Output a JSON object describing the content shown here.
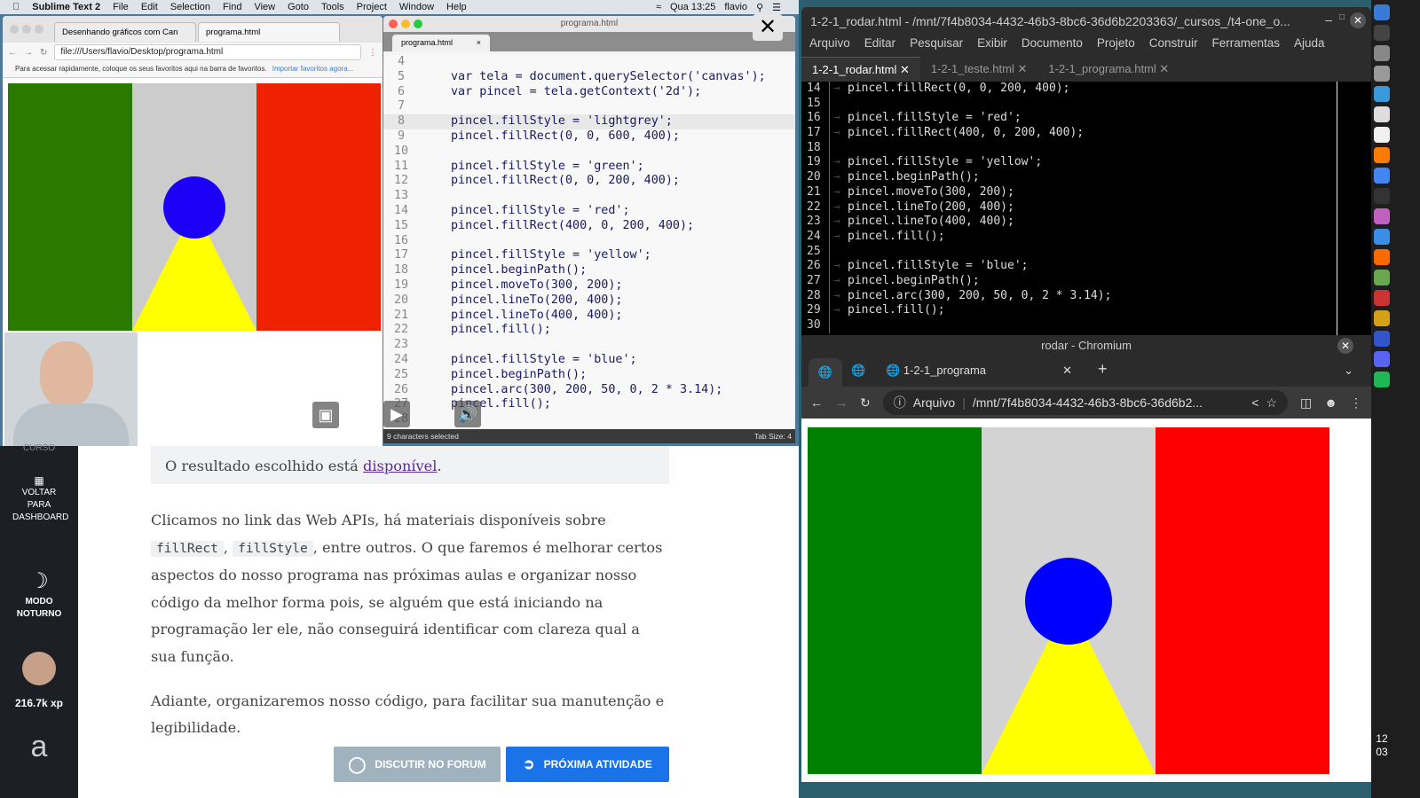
{
  "mac_menubar": {
    "app": "Sublime Text 2",
    "items": [
      "File",
      "Edit",
      "Selection",
      "Find",
      "View",
      "Goto",
      "Tools",
      "Project",
      "Window",
      "Help"
    ],
    "clock": "Qua 13:25",
    "user": "flavio"
  },
  "left_browser": {
    "tabs": [
      "Desenhando gráficos com Can",
      "programa.html"
    ],
    "url": "file:///Users/flavio/Desktop/programa.html",
    "bookmarks_hint": "Para acessar rapidamente, coloque os seus favoritos aqui na barra de favoritos.",
    "bookmarks_link": "Importar favoritos agora..."
  },
  "flag_colors": {
    "left": "#2a7a00",
    "middle": "#cccccc",
    "right": "#ee2200",
    "circle": "#1c00f6",
    "triangle": "#ffff00"
  },
  "sublime": {
    "window_title": "programa.html",
    "tab": "programa.html",
    "status_left": "9 characters selected",
    "status_right": "Tab Size: 4",
    "first_line": 4,
    "lines": [
      "",
      "var tela = document.querySelector('canvas');",
      "var pincel = tela.getContext('2d');",
      "",
      "pincel.fillStyle = 'lightgrey';",
      "pincel.fillRect(0, 0, 600, 400);",
      "",
      "pincel.fillStyle = 'green';",
      "pincel.fillRect(0, 0, 200, 400);",
      "",
      "pincel.fillStyle = 'red';",
      "pincel.fillRect(400, 0, 200, 400);",
      "",
      "pincel.fillStyle = 'yellow';",
      "pincel.beginPath();",
      "pincel.moveTo(300, 200);",
      "pincel.lineTo(200, 400);",
      "pincel.lineTo(400, 400);",
      "pincel.fill();",
      "",
      "pincel.fillStyle = 'blue';",
      "pincel.beginPath();",
      "pincel.arc(300, 200, 50, 0, 2 * 3.14);",
      "pincel.fill();",
      ""
    ]
  },
  "alura": {
    "sidebar": {
      "curso": "CURSO",
      "dashboard": "VOLTAR PARA DASHBOARD",
      "night": "MODO NOTURNO",
      "xp": "216.7k xp"
    },
    "result_prefix": "O resultado escolhido está ",
    "result_link": "disponível",
    "result_suffix": ".",
    "p1_a": "Clicamos no link das Web APIs, há materiais disponíveis sobre ",
    "code1": "fillRect",
    "p1_b": ",",
    "code2": "fillStyle",
    "p1_c": ", entre outros. O que faremos é melhorar certos aspectos do nosso programa nas próximas aulas e organizar nosso código da melhor forma pois, se alguém que está iniciando na programação ler ele, não conseguirá identificar com clareza qual a sua função.",
    "p2": "Adiante, organizaremos nosso código, para facilitar sua manutenção e legibilidade.",
    "forum_button": "DISCUTIR NO FORUM",
    "next_button": "PRÓXIMA ATIVIDADE"
  },
  "geany": {
    "title": "1-2-1_rodar.html - /mnt/7f4b8034-4432-46b3-8bc6-36d6b2203363/_cursos_/t4-one_o...",
    "menu": [
      "Arquivo",
      "Editar",
      "Pesquisar",
      "Exibir",
      "Documento",
      "Projeto",
      "Construir",
      "Ferramentas",
      "Ajuda"
    ],
    "tabs": [
      "1-2-1_rodar.html",
      "1-2-1_teste.html",
      "1-2-1_programa.html"
    ],
    "first_line": 14,
    "lines": [
      "pincel.fillRect(0, 0, 200, 400);",
      "",
      "pincel.fillStyle = 'red';",
      "pincel.fillRect(400, 0, 200, 400);",
      "",
      "pincel.fillStyle = 'yellow';",
      "pincel.beginPath();",
      "pincel.moveTo(300, 200);",
      "pincel.lineTo(200, 400);",
      "pincel.lineTo(400, 400);",
      "pincel.fill();",
      "",
      "pincel.fillStyle = 'blue';",
      "pincel.beginPath();",
      "pincel.arc(300, 200, 50, 0, 2 * 3.14);",
      "pincel.fill();",
      ""
    ]
  },
  "chromium": {
    "title": "rodar - Chromium",
    "tab": "1-2-1_programa",
    "scheme_label": "Arquivo",
    "url": "/mnt/7f4b8034-4432-46b3-8bc6-36d6b2..."
  },
  "dock": {
    "clock_h": "12",
    "clock_m": "03"
  },
  "right_flag_colors": {
    "left": "#008000",
    "middle": "#d3d3d3",
    "right": "#ff0000",
    "circle": "#0000ff",
    "triangle": "#ffff00"
  }
}
